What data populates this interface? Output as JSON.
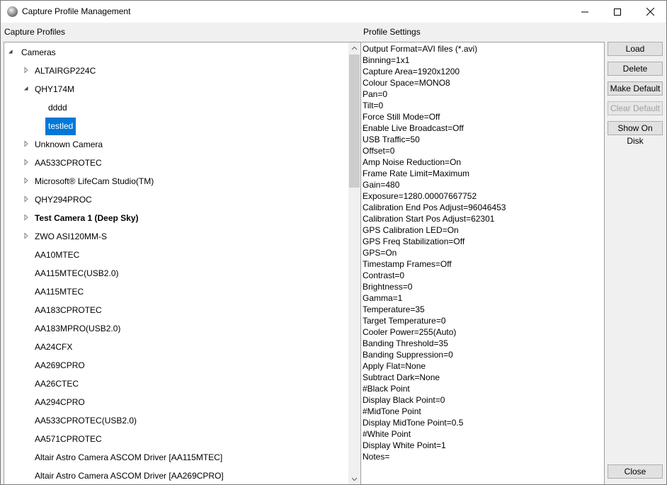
{
  "window": {
    "title": "Capture Profile Management"
  },
  "profiles_label": "Capture Profiles",
  "settings_label": "Profile Settings",
  "tree": [
    {
      "label": "Cameras",
      "toggle": "expanded",
      "level": 0,
      "name": "tree-item-cameras"
    },
    {
      "label": "ALTAIRGP224C",
      "toggle": "collapsed",
      "level": 1,
      "name": "tree-item-altairgp224c"
    },
    {
      "label": "QHY174M",
      "toggle": "expanded",
      "level": 1,
      "name": "tree-item-qhy174m"
    },
    {
      "label": "dddd",
      "toggle": "none",
      "level": 2,
      "name": "tree-item-dddd"
    },
    {
      "label": "testled",
      "toggle": "none",
      "level": 2,
      "selected": true,
      "name": "tree-item-testled"
    },
    {
      "label": "Unknown Camera",
      "toggle": "collapsed",
      "level": 1,
      "name": "tree-item-unknown-camera"
    },
    {
      "label": "AA533CPROTEC",
      "toggle": "collapsed",
      "level": 1,
      "name": "tree-item-aa533cprotec"
    },
    {
      "label": "Microsoft® LifeCam Studio(TM)",
      "toggle": "collapsed",
      "level": 1,
      "name": "tree-item-microsoft-lifecam"
    },
    {
      "label": "QHY294PROC",
      "toggle": "collapsed",
      "level": 1,
      "name": "tree-item-qhy294proc"
    },
    {
      "label": "Test Camera 1 (Deep Sky)",
      "toggle": "collapsed",
      "level": 1,
      "bold": true,
      "name": "tree-item-test-camera-1"
    },
    {
      "label": "ZWO ASI120MM-S",
      "toggle": "collapsed",
      "level": 1,
      "name": "tree-item-zwo-asi120mm-s"
    },
    {
      "label": "AA10MTEC",
      "toggle": "none",
      "level": 1,
      "name": "tree-item-aa10mtec"
    },
    {
      "label": "AA115MTEC(USB2.0)",
      "toggle": "none",
      "level": 1,
      "name": "tree-item-aa115mtec-usb2"
    },
    {
      "label": "AA115MTEC",
      "toggle": "none",
      "level": 1,
      "name": "tree-item-aa115mtec"
    },
    {
      "label": "AA183CPROTEC",
      "toggle": "none",
      "level": 1,
      "name": "tree-item-aa183cprotec"
    },
    {
      "label": "AA183MPRO(USB2.0)",
      "toggle": "none",
      "level": 1,
      "name": "tree-item-aa183mpro-usb2"
    },
    {
      "label": "AA24CFX",
      "toggle": "none",
      "level": 1,
      "name": "tree-item-aa24cfx"
    },
    {
      "label": "AA269CPRO",
      "toggle": "none",
      "level": 1,
      "name": "tree-item-aa269cpro"
    },
    {
      "label": "AA26CTEC",
      "toggle": "none",
      "level": 1,
      "name": "tree-item-aa26ctec"
    },
    {
      "label": "AA294CPRO",
      "toggle": "none",
      "level": 1,
      "name": "tree-item-aa294cpro"
    },
    {
      "label": "AA533CPROTEC(USB2.0)",
      "toggle": "none",
      "level": 1,
      "name": "tree-item-aa533cprotec-usb2"
    },
    {
      "label": "AA571CPROTEC",
      "toggle": "none",
      "level": 1,
      "name": "tree-item-aa571cprotec"
    },
    {
      "label": "Altair Astro Camera ASCOM Driver [AA115MTEC]",
      "toggle": "none",
      "level": 1,
      "name": "tree-item-altair-ascom-aa115mtec"
    },
    {
      "label": "Altair Astro Camera ASCOM Driver [AA269CPRO]",
      "toggle": "none",
      "level": 1,
      "name": "tree-item-altair-ascom-aa269cpro"
    }
  ],
  "settings": [
    "Output Format=AVI files (*.avi)",
    "Binning=1x1",
    "Capture Area=1920x1200",
    "Colour Space=MONO8",
    "Pan=0",
    "Tilt=0",
    "Force Still Mode=Off",
    "Enable Live Broadcast=Off",
    "USB Traffic=50",
    "Offset=0",
    "Amp Noise Reduction=On",
    "Frame Rate Limit=Maximum",
    "Gain=480",
    "Exposure=1280.00007667752",
    "Calibration End Pos Adjust=96046453",
    "Calibration Start Pos Adjust=62301",
    "GPS Calibration LED=On",
    "GPS Freq Stabilization=Off",
    "GPS=On",
    "Timestamp Frames=Off",
    "Contrast=0",
    "Brightness=0",
    "Gamma=1",
    "Temperature=35",
    "Target Temperature=0",
    "Cooler Power=255(Auto)",
    "Banding Threshold=35",
    "Banding Suppression=0",
    "Apply Flat=None",
    "Subtract Dark=None",
    "#Black Point",
    "Display Black Point=0",
    "#MidTone Point",
    "Display MidTone Point=0.5",
    "#White Point",
    "Display White Point=1",
    "Notes="
  ],
  "buttons": {
    "load": "Load",
    "delete": "Delete",
    "make_default": "Make Default",
    "clear_default": "Clear Default",
    "show_on_disk": "Show On Disk",
    "close": "Close"
  },
  "colors": {
    "selection": "#0078d7",
    "panel_bg": "#f0f0f0"
  }
}
